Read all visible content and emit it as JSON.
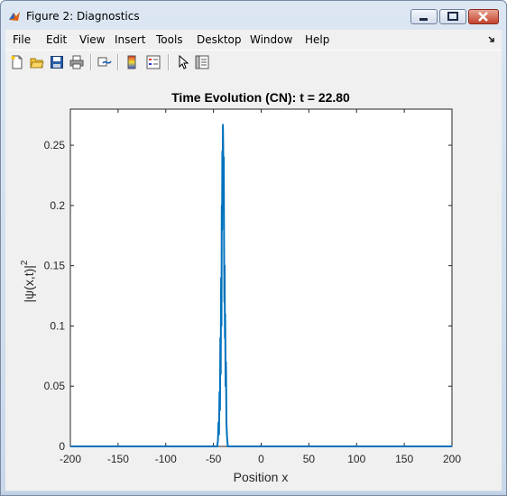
{
  "window": {
    "title": "Figure 2: Diagnostics",
    "controls": {
      "minimize": "minimize",
      "maximize": "maximize",
      "close": "close"
    }
  },
  "menu": [
    "File",
    "Edit",
    "View",
    "Insert",
    "Tools",
    "Desktop",
    "Window",
    "Help"
  ],
  "toolbar": {
    "icons": [
      "new-figure-icon",
      "open-file-icon",
      "save-icon",
      "print-icon",
      "link-plot-icon",
      "colorbar-icon",
      "legend-icon",
      "edit-plot-arrow-icon",
      "property-inspector-icon"
    ]
  },
  "colors": {
    "line": "#0072bd",
    "title_bar": "#dce7f3",
    "figure_bg": "#f0f0f0"
  },
  "chart_data": {
    "type": "line",
    "title": "Time Evolution (CN): t = 22.80",
    "xlabel": "Position x",
    "ylabel_base": "|ψ(x,t)|",
    "ylabel_sup": "2",
    "xlim": [
      -200,
      200
    ],
    "ylim": [
      0,
      0.28
    ],
    "xticks": [
      -200,
      -150,
      -100,
      -50,
      0,
      50,
      100,
      150,
      200
    ],
    "yticks": [
      0,
      0.05,
      0.1,
      0.15,
      0.2,
      0.25
    ],
    "ytick_labels": [
      "0",
      "0.05",
      "0.1",
      "0.15",
      "0.2",
      "0.25"
    ],
    "grid": false,
    "series": [
      {
        "x": [
          -200,
          -46,
          -45.3,
          -44.7,
          -44.2,
          -43.7,
          -43.2,
          -42.8,
          -42.4,
          -42,
          -41.6,
          -41.3,
          -41,
          -40.7,
          -40.4,
          -40.1,
          -39.8,
          -39.5,
          -39.2,
          -38.9,
          -38.6,
          -38.3,
          -38,
          -37.7,
          -37.3,
          -36.9,
          -36.4,
          -35.8,
          -35,
          200
        ],
        "y": [
          0,
          0,
          0.005,
          0.02,
          0.01,
          0.045,
          0.03,
          0.09,
          0.06,
          0.14,
          0.1,
          0.2,
          0.18,
          0.245,
          0.22,
          0.267,
          0.25,
          0.2,
          0.24,
          0.17,
          0.12,
          0.15,
          0.09,
          0.11,
          0.05,
          0.07,
          0.02,
          0.008,
          0,
          0
        ]
      }
    ]
  }
}
